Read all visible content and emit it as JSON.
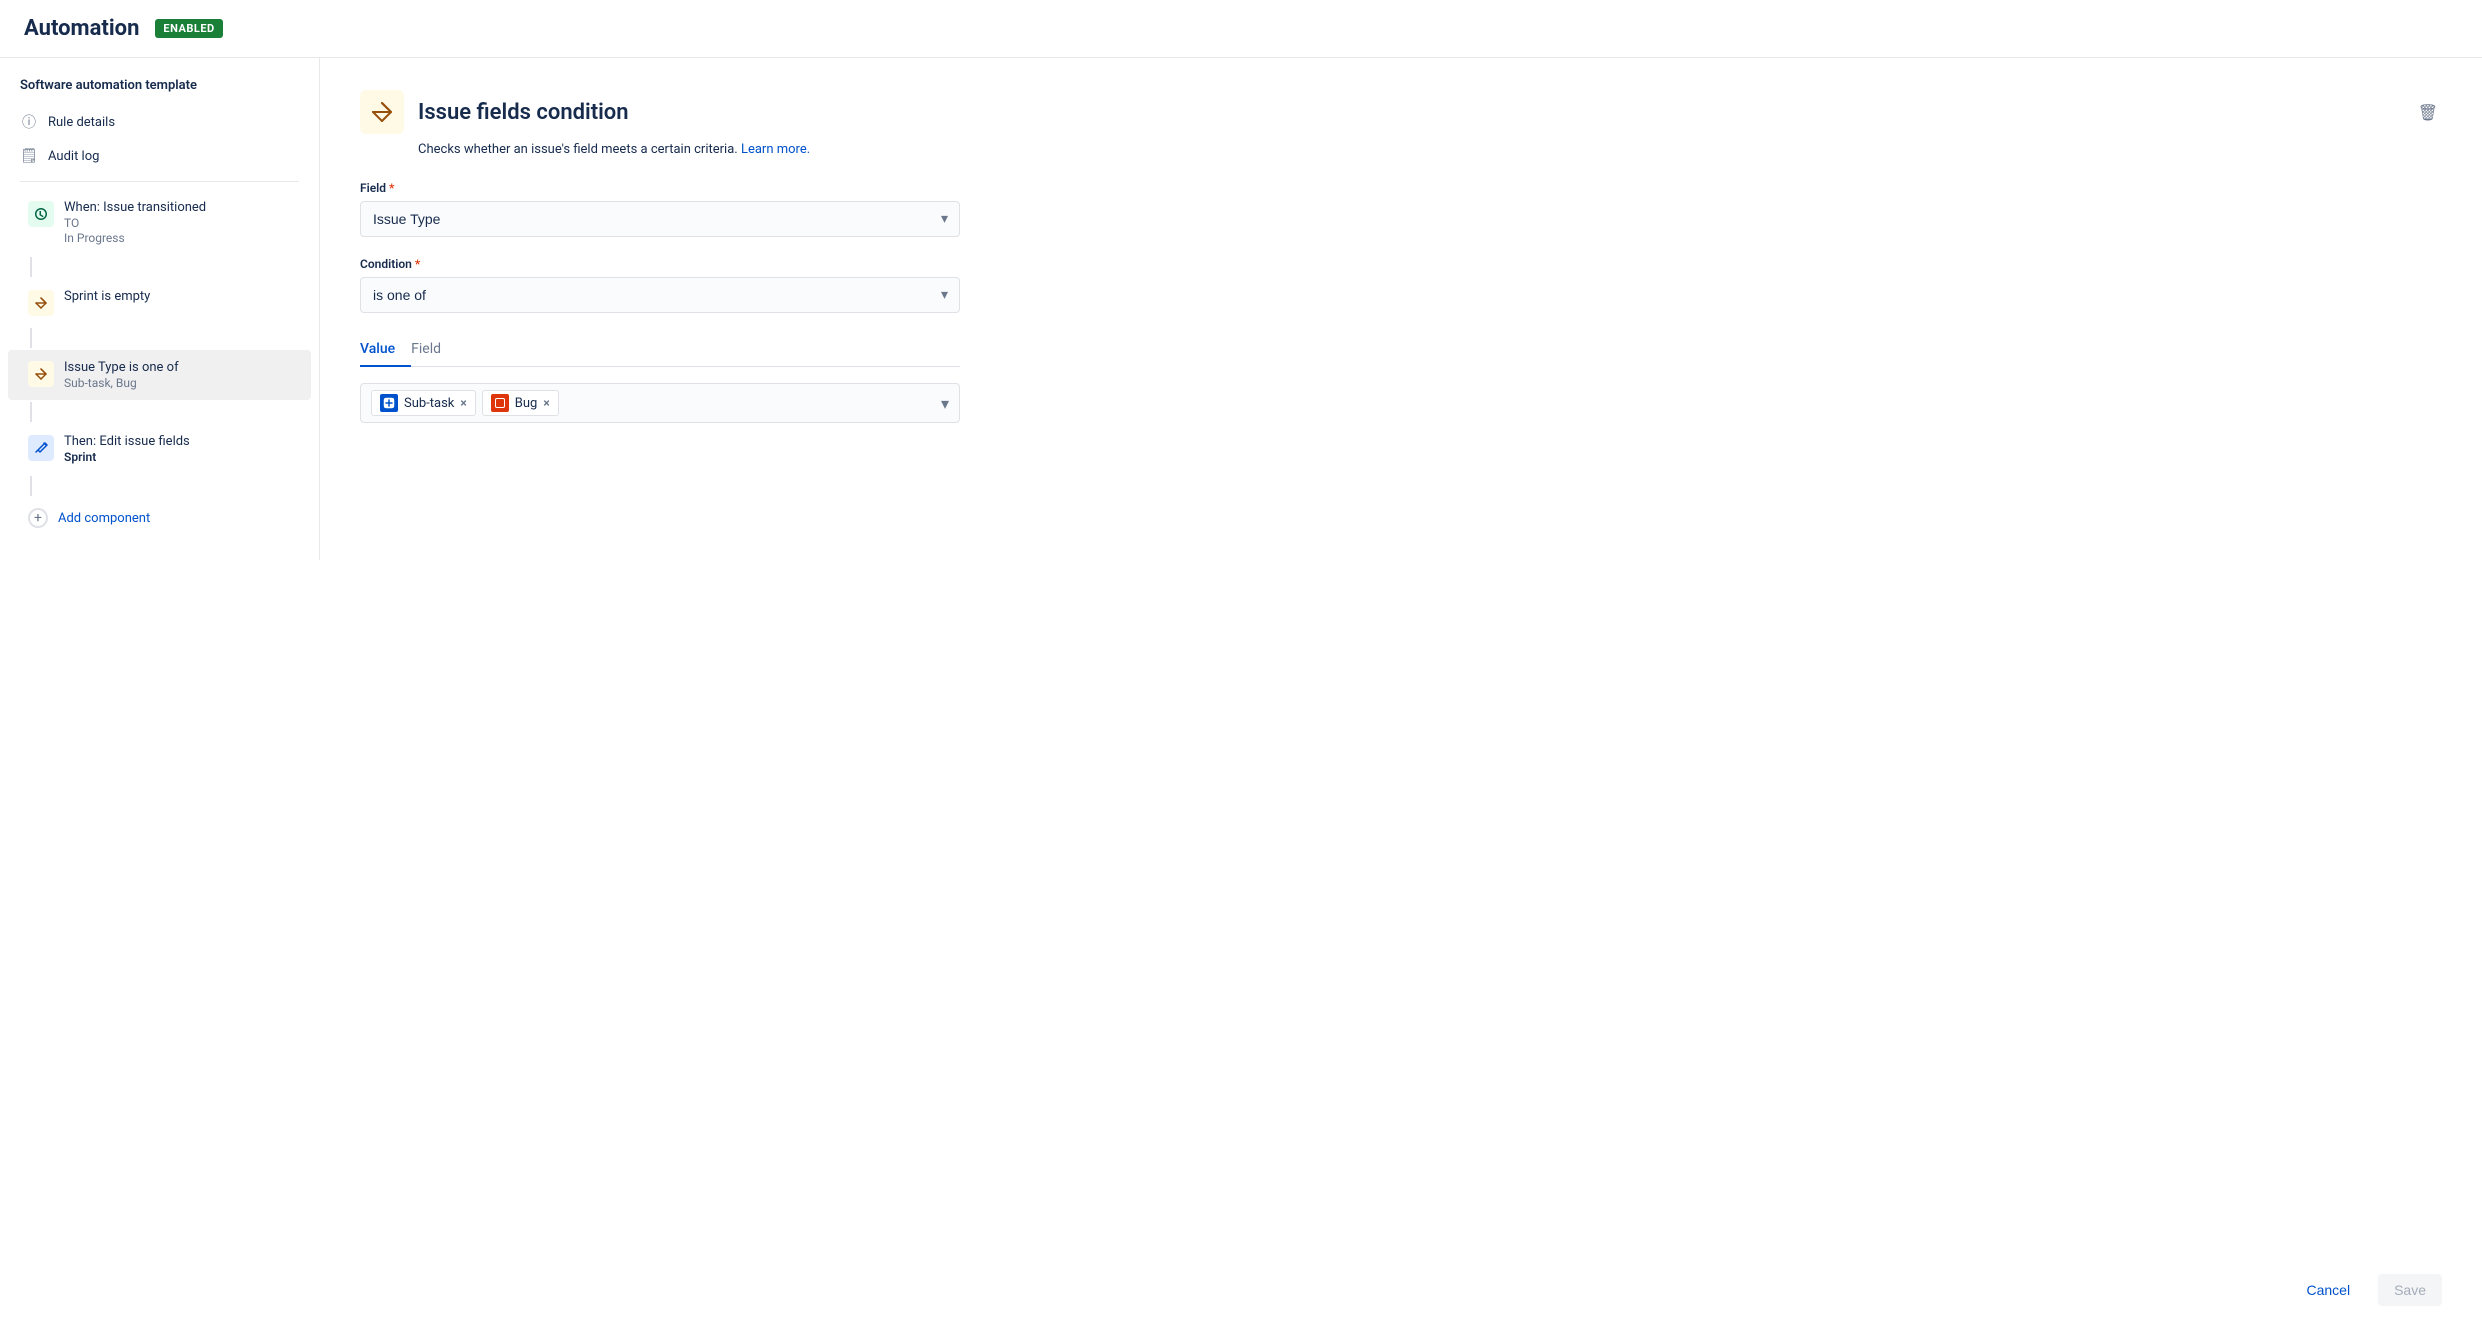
{
  "header": {
    "title": "Automation",
    "badge": "ENABLED"
  },
  "sidebar": {
    "template_label": "Software automation template",
    "nav_items": [
      {
        "id": "rule-details",
        "label": "Rule details",
        "icon": "ℹ"
      },
      {
        "id": "audit-log",
        "label": "Audit log",
        "icon": "📋"
      }
    ],
    "components": [
      {
        "id": "when-trigger",
        "icon": "↺",
        "icon_color": "green",
        "title": "When: Issue transitioned",
        "subtitle_prefix": "TO",
        "subtitle": "In Progress",
        "subtitle_bold": false
      },
      {
        "id": "sprint-condition",
        "icon": "⇄",
        "icon_color": "yellow",
        "title": "Sprint is empty",
        "subtitle": null
      },
      {
        "id": "issue-type-condition",
        "icon": "⇄",
        "icon_color": "yellow",
        "title": "Issue Type is one of",
        "subtitle": "Sub-task, Bug",
        "active": true
      },
      {
        "id": "then-action",
        "icon": "✏",
        "icon_color": "blue",
        "title": "Then: Edit issue fields",
        "subtitle": "Sprint",
        "subtitle_bold": true
      }
    ],
    "add_component_label": "Add component"
  },
  "condition_panel": {
    "icon": "⇄",
    "title": "Issue fields condition",
    "description": "Checks whether an issue's field meets a certain criteria.",
    "learn_more_label": "Learn more.",
    "field_label": "Field",
    "field_required": true,
    "field_value": "Issue Type",
    "condition_label": "Condition",
    "condition_required": true,
    "condition_value": "is one of",
    "tabs": [
      {
        "id": "value",
        "label": "Value",
        "active": true
      },
      {
        "id": "field",
        "label": "Field",
        "active": false
      }
    ],
    "tags": [
      {
        "id": "subtask",
        "label": "Sub-task",
        "icon_type": "subtask",
        "icon_char": "⊞"
      },
      {
        "id": "bug",
        "label": "Bug",
        "icon_type": "bug",
        "icon_char": "■"
      }
    ]
  },
  "actions": {
    "cancel_label": "Cancel",
    "save_label": "Save"
  }
}
